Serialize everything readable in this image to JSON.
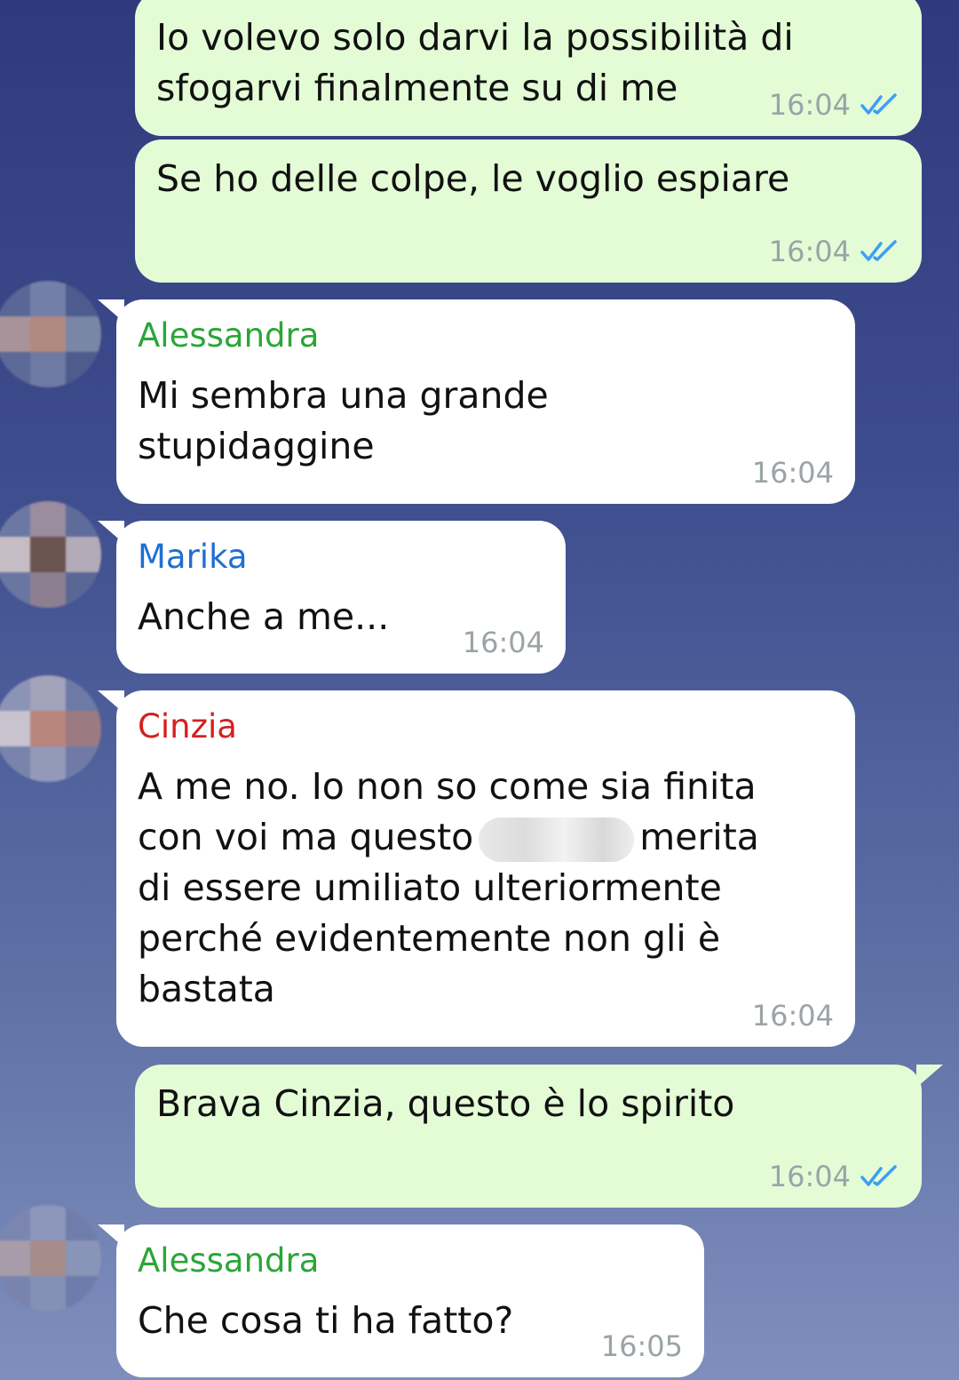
{
  "messages": [
    {
      "text": "Io volevo solo darvi la possibilità di\nsfogarvi finalmente su di me",
      "time": "16:04"
    },
    {
      "text": "Se ho delle colpe, le voglio espiare",
      "time": "16:04"
    },
    {
      "sender": "Alessandra",
      "text": "Mi sembra una grande\nstupidaggine",
      "time": "16:04"
    },
    {
      "sender": "Marika",
      "text": "Anche a me...",
      "time": "16:04"
    },
    {
      "sender": "Cinzia",
      "text_a": "A me no. Io non so come sia finita\ncon voi ma questo",
      "text_b": "merita\ndi essere umiliato ulteriormente\nperché evidentemente non gli è\nbastata",
      "time": "16:04"
    },
    {
      "text": "Brava Cinzia, questo è lo spirito",
      "time": "16:04"
    },
    {
      "sender": "Alessandra",
      "text": "Che cosa ti ha fatto?",
      "time": "16:05"
    }
  ],
  "colors": {
    "outgoing_bubble": "#e4fcd6",
    "incoming_bubble": "#ffffff",
    "sender_alessandra": "#2aa637",
    "sender_marika": "#1f6fd0",
    "sender_cinzia": "#d42020",
    "read_ticks": "#3e9ef5"
  },
  "icons": {
    "read_receipt": "double-check-icon",
    "avatar": "pixelated-avatar"
  }
}
